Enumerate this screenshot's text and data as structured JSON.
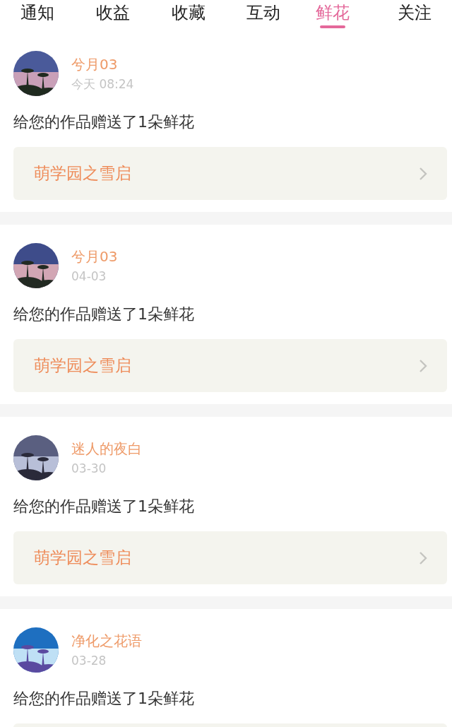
{
  "tabs": [
    {
      "label": "通知",
      "selected": false
    },
    {
      "label": "收益",
      "selected": false
    },
    {
      "label": "收藏",
      "selected": false
    },
    {
      "label": "互动",
      "selected": false
    },
    {
      "label": "鲜花",
      "selected": true
    },
    {
      "label": "关注",
      "selected": false
    }
  ],
  "items": [
    {
      "name": "兮月03",
      "time": "今天 08:24",
      "message": "给您的作品赠送了1朵鲜花",
      "work": "萌学园之雪启"
    },
    {
      "name": "兮月03",
      "time": "04-03",
      "message": "给您的作品赠送了1朵鲜花",
      "work": "萌学园之雪启"
    },
    {
      "name": "迷人的夜白",
      "time": "03-30",
      "message": "给您的作品赠送了1朵鲜花",
      "work": "萌学园之雪启"
    },
    {
      "name": "净化之花语",
      "time": "03-28",
      "message": "给您的作品赠送了1朵鲜花"
    }
  ]
}
